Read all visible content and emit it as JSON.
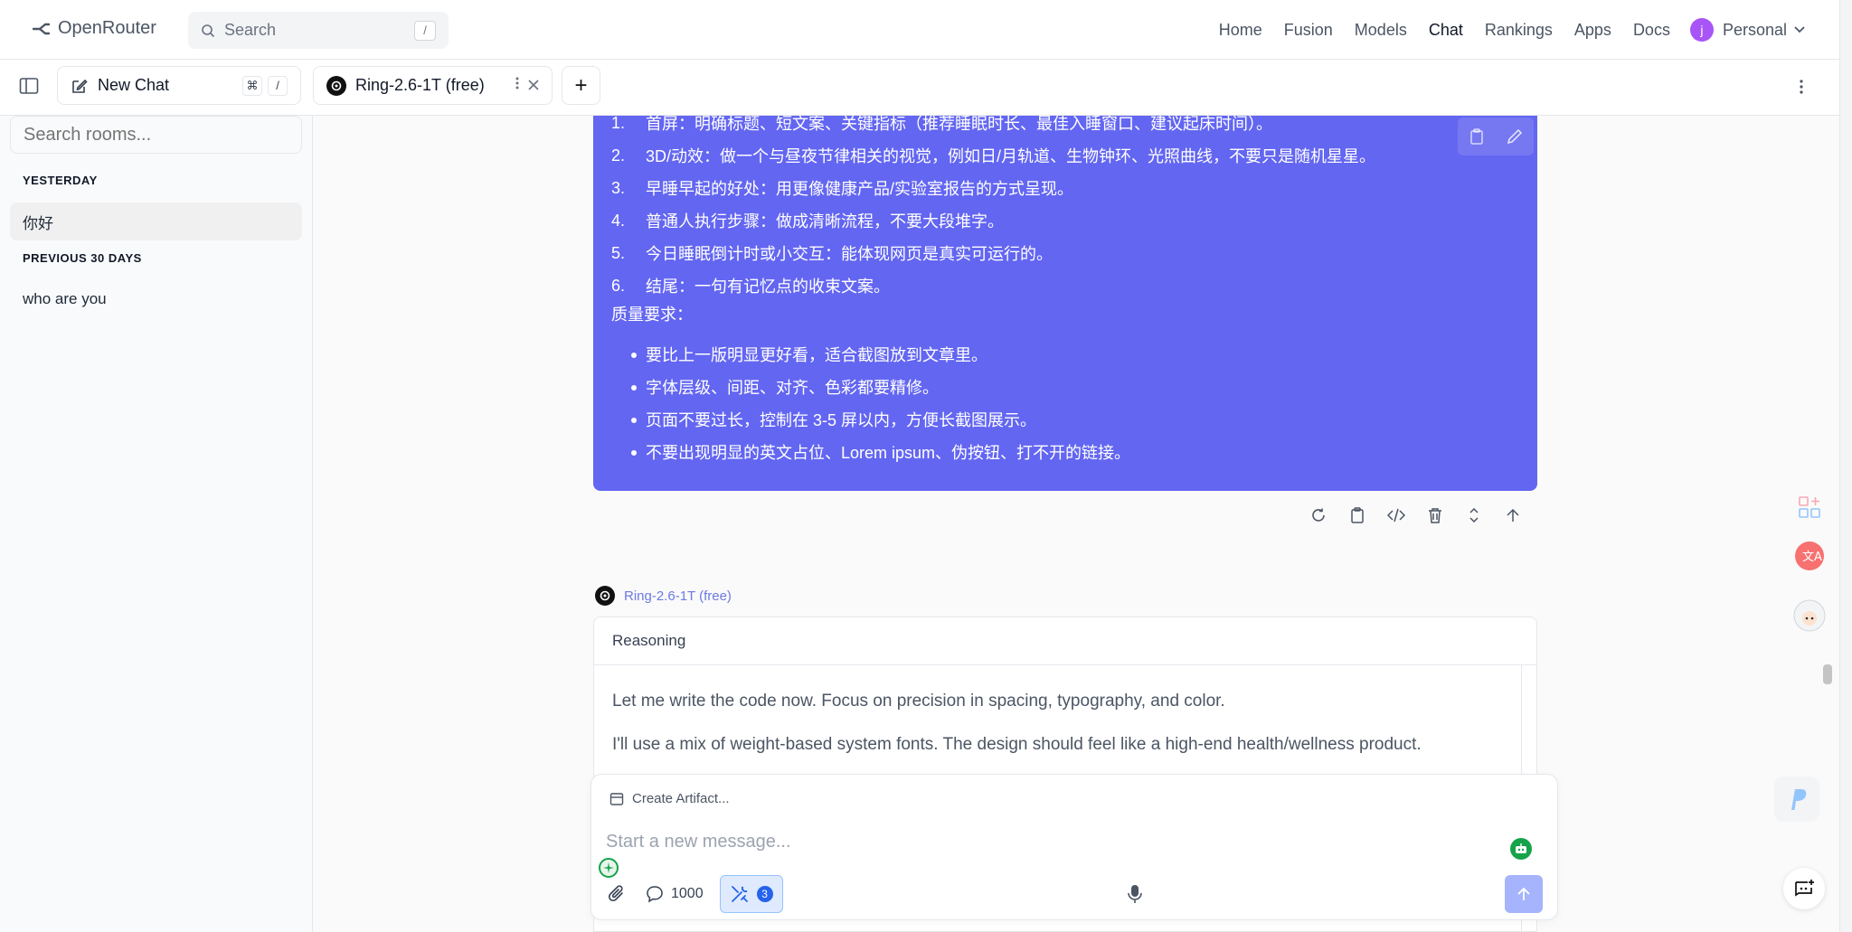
{
  "header": {
    "brand": "OpenRouter",
    "search_placeholder": "Search",
    "search_shortcut": "/",
    "nav": [
      "Home",
      "Fusion",
      "Models",
      "Chat",
      "Rankings",
      "Apps",
      "Docs"
    ],
    "nav_active": "Chat",
    "account_initial": "j",
    "account_label": "Personal"
  },
  "tabs": {
    "new_chat_label": "New Chat",
    "new_chat_shortcut": [
      "⌘",
      "/"
    ],
    "active_tab_label": "Ring-2.6-1T (free)",
    "add_tab": "+"
  },
  "sidebar": {
    "search_placeholder": "Search rooms...",
    "sections": [
      {
        "heading": "YESTERDAY",
        "items": [
          "你好"
        ]
      },
      {
        "heading": "PREVIOUS 30 DAYS",
        "items": [
          "who are you"
        ]
      }
    ]
  },
  "user_message": {
    "ordered": [
      {
        "n": "1.",
        "text": "首屏：明确标题、短文案、关键指标（推荐睡眠时长、最佳入睡窗口、建议起床时间）。"
      },
      {
        "n": "2.",
        "text": "3D/动效：做一个与昼夜节律相关的视觉，例如日/月轨道、生物钟环、光照曲线，不要只是随机星星。"
      },
      {
        "n": "3.",
        "text": "早睡早起的好处：用更像健康产品/实验室报告的方式呈现。"
      },
      {
        "n": "4.",
        "text": "普通人执行步骤：做成清晰流程，不要大段堆字。"
      },
      {
        "n": "5.",
        "text": "今日睡眠倒计时或小交互：能体现网页是真实可运行的。"
      },
      {
        "n": "6.",
        "text": "结尾：一句有记忆点的收束文案。"
      }
    ],
    "quality_heading": "质量要求：",
    "quality_items": [
      "要比上一版明显更好看，适合截图放到文章里。",
      "字体层级、间距、对齐、色彩都要精修。",
      "页面不要过长，控制在 3-5 屏以内，方便长截图展示。",
      "不要出现明显的英文占位、Lorem ipsum、伪按钮、打不开的链接。"
    ]
  },
  "assistant": {
    "model_label": "Ring-2.6-1T (free)",
    "reasoning_heading": "Reasoning",
    "reasoning_lines": [
      "Let me write the code now. Focus on precision in spacing, typography, and color.",
      "I'll use a mix of weight-based system fonts. The design should feel like a high-end health/wellness product."
    ]
  },
  "composer": {
    "create_artifact": "Create Artifact...",
    "placeholder": "Start a new message...",
    "context_count": "1000",
    "tools_count": "3"
  },
  "colors": {
    "accent": "#6366f1",
    "send_disabled": "#a5b4fc",
    "green": "#16a34a"
  }
}
